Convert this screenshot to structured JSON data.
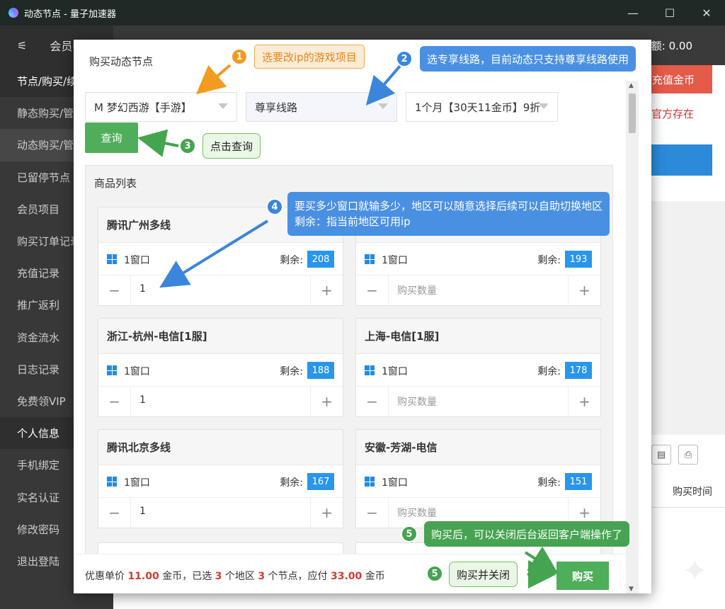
{
  "window": {
    "title": "动态节点 - 量子加速器",
    "min": "—",
    "max": "☐",
    "close": "✕"
  },
  "sidebar": {
    "menu_icon": "sliders-icon",
    "top_text": "会员中心",
    "items": [
      {
        "label": "节点/购买/续费",
        "group": true
      },
      {
        "label": "静态购买/管理"
      },
      {
        "label": "动态购买/管理",
        "active": true
      },
      {
        "label": "已留停节点"
      },
      {
        "label": "会员项目"
      },
      {
        "label": "购买订单记录"
      },
      {
        "label": "充值记录"
      },
      {
        "label": "推广返利"
      },
      {
        "label": "资金流水"
      },
      {
        "label": "日志记录"
      },
      {
        "label": "免费领VIP"
      },
      {
        "label": "个人信息",
        "group": true
      },
      {
        "label": "手机绑定"
      },
      {
        "label": "实名认证"
      },
      {
        "label": "修改密码"
      },
      {
        "label": "退出登陆"
      }
    ]
  },
  "background": {
    "balance": "额: 0.00",
    "recharge": "充值金币",
    "warning": "官方存在",
    "purchase_time": "购买时间"
  },
  "modal": {
    "title": "购买动态节点",
    "game_select": "M 梦幻西游【手游】",
    "line_select": "尊享线路",
    "duration_select": "1个月【30天11金币】9折",
    "query": "查询",
    "list_title": "商品列表",
    "window_label": "1窗口",
    "remain_label": "剩余:",
    "minus": "−",
    "plus": "+",
    "placeholder": "购买数量",
    "nodes": [
      {
        "name": "腾讯广州多线",
        "remain": "208",
        "qty": "1"
      },
      {
        "name": "",
        "remain": "193",
        "qty": ""
      },
      {
        "name": "浙江-杭州-电信[1服]",
        "remain": "188",
        "qty": "1"
      },
      {
        "name": "上海-电信[1服]",
        "remain": "178",
        "qty": ""
      },
      {
        "name": "腾讯北京多线",
        "remain": "167",
        "qty": "1"
      },
      {
        "name": "安徽-芳湖-电信",
        "remain": "151",
        "qty": ""
      }
    ],
    "footer": {
      "p1": "优惠单价 ",
      "price": "11.00",
      "p2": " 金币，已选 ",
      "regions": "3",
      "p3": " 个地区 ",
      "nodes": "3",
      "p4": " 个节点，应付 ",
      "total": "33.00",
      "p5": " 金币"
    },
    "buy": "购买"
  },
  "annotations": {
    "a1": {
      "num": "1",
      "text": "选要改ip的游戏项目"
    },
    "a2": {
      "num": "2",
      "text": "选专享线路，目前动态只支持尊享线路使用"
    },
    "a3": {
      "num": "3",
      "text": "点击查询"
    },
    "a4": {
      "num": "4",
      "line1": "要买多少窗口就输多少，地区可以随意选择后续可以自助切换地区",
      "line2": "剩余：指当前地区可用ip"
    },
    "a5a": {
      "num": "5",
      "text": "购买后，可以关闭后台返回客户端操作了"
    },
    "a5b": {
      "num": "5",
      "text": "购买并关闭"
    }
  },
  "colors": {
    "green": "#4fae5a",
    "blue": "#2896ea",
    "orange": "#f39a21",
    "red": "#d63b2f"
  }
}
